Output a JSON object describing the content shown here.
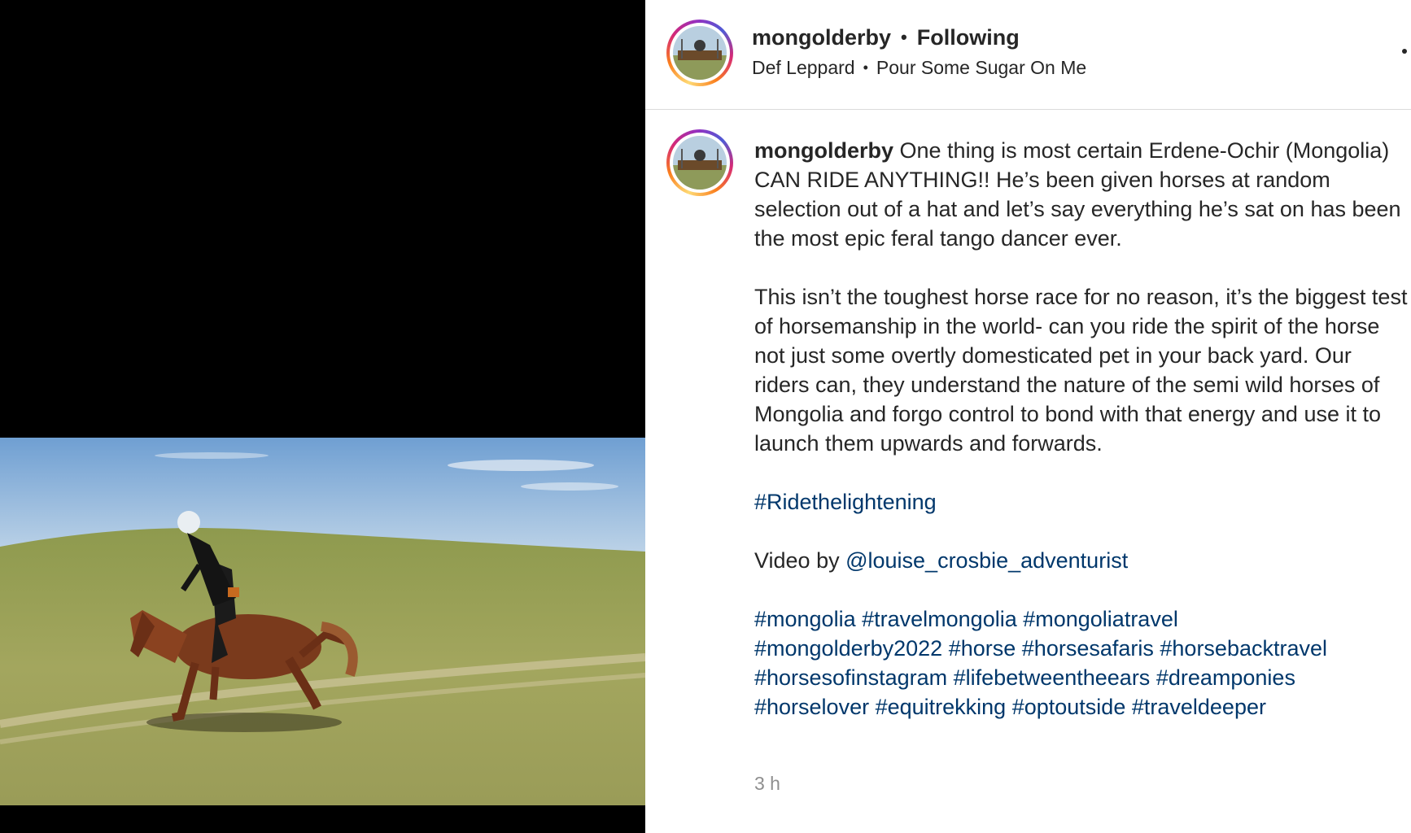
{
  "post": {
    "username": "mongolderby",
    "separator": "•",
    "follow_status": "Following",
    "music_artist": "Def Leppard",
    "music_separator": "•",
    "music_title": "Pour Some Sugar On Me"
  },
  "caption": {
    "username": "mongolderby",
    "para1": " One thing is most certain Erdene-Ochir (Mongolia) CAN RIDE ANYTHING!! He’s been given horses at random selection out of a hat and let’s say everything he’s sat on has been the most epic feral tango dancer ever.",
    "para2": "This isn’t the toughest horse race for no reason, it’s the biggest test of horsemanship in the world- can you ride the spirit of the horse not just some overtly domesticated pet in your back yard. Our riders can, they understand the nature of the semi wild horses of Mongolia and forgo control to bond with that energy and use it to launch them upwards and forwards.",
    "hashtag_single": "#Ridethelightening",
    "video_by_prefix": "Video by ",
    "video_by_mention": "@louise_crosbie_adventurist",
    "hashtags": [
      "#mongolia",
      "#travelmongolia",
      "#mongoliatravel",
      "#mongolderby2022",
      "#horse",
      "#horsesafaris",
      "#horsebacktravel",
      "#horsesofinstagram",
      "#lifebetweentheears",
      "#dreamponies",
      "#horselover",
      "#equitrekking",
      "#optoutside",
      "#traveldeeper"
    ],
    "timestamp": "3 h"
  },
  "colors": {
    "link": "#00376b",
    "text": "#262626",
    "muted": "#8e8e8e",
    "divider": "#dbdbdb",
    "media_background": "#000000"
  },
  "icons": {
    "more": "more-options-icon",
    "avatar": "profile-avatar"
  }
}
